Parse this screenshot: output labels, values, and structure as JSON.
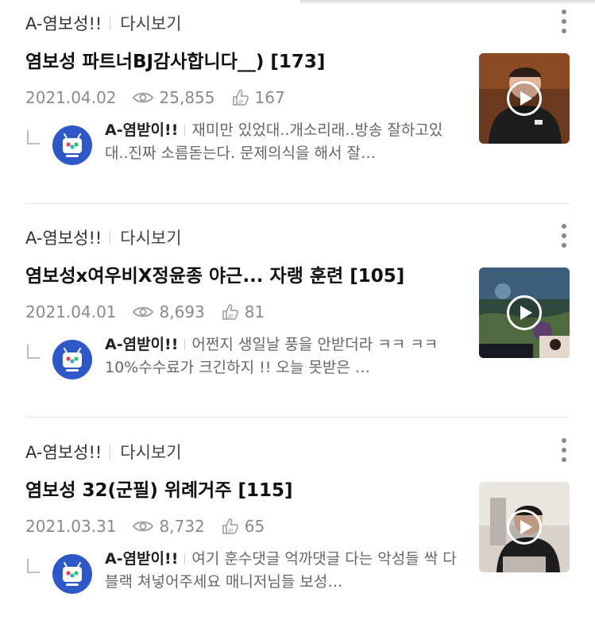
{
  "feed": [
    {
      "channel": "A-염보성!!",
      "replay_label": "다시보기",
      "title": "염보성 파트너BJ감사합니다__) [173]",
      "date": "2021.04.02",
      "views": "25,855",
      "likes": "167",
      "comment_author": "A-염받이!!",
      "comment_text": "재미만 있었대..개소리래..방송 잘하고있대..진짜 소름돋는다. 문제의식을 해서 잘…",
      "thumb_theme": "portrait"
    },
    {
      "channel": "A-염보성!!",
      "replay_label": "다시보기",
      "title": "염보성x여우비X정윤종 야근... 자랭 훈련 [105]",
      "date": "2021.04.01",
      "views": "8,693",
      "likes": "81",
      "comment_author": "A-염받이!!",
      "comment_text": "어쩐지 생일날 풍을 안받더라 ㅋㅋ ㅋㅋ 10%수수료가 크긴하지 !! 오늘 못받은 …",
      "thumb_theme": "game"
    },
    {
      "channel": "A-염보성!!",
      "replay_label": "다시보기",
      "title": "염보성 32(군필) 위례거주 [115]",
      "date": "2021.03.31",
      "views": "8,732",
      "likes": "65",
      "comment_author": "A-염받이!!",
      "comment_text": "여기 훈수댓글 억까댓글 다는 악성들 싹 다 블랙 쳐넣어주세요 매니저님들 보성…",
      "thumb_theme": "room"
    }
  ],
  "colors": {
    "meta_text": "#8a8a8a",
    "avatar_bg": "#2e57c8",
    "divider": "#e6e6e6"
  },
  "icons": [
    "eye-icon",
    "thumbs-up-icon",
    "more-vertical-icon",
    "play-icon",
    "reply-corner-icon"
  ]
}
